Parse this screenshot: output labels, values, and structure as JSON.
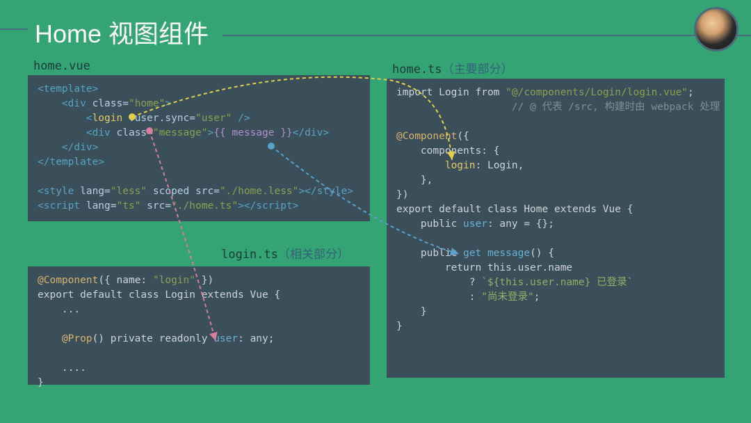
{
  "title": "Home 视图组件",
  "panels": {
    "homeVue": {
      "filename": "home.vue",
      "lines": [
        [
          {
            "t": "tag",
            "v": "<template>"
          }
        ],
        [
          {
            "t": "text",
            "v": "    "
          },
          {
            "t": "tag",
            "v": "<div "
          },
          {
            "t": "attr",
            "v": "class="
          },
          {
            "t": "str",
            "v": "\"home\""
          },
          {
            "t": "tag",
            "v": ">"
          }
        ],
        [
          {
            "t": "text",
            "v": "        "
          },
          {
            "t": "tag",
            "v": "<"
          },
          {
            "t": "component",
            "v": "login "
          },
          {
            "t": "attr",
            "v": ":user.sync="
          },
          {
            "t": "str",
            "v": "\"user\""
          },
          {
            "t": "tag",
            "v": " />"
          }
        ],
        [
          {
            "t": "text",
            "v": "        "
          },
          {
            "t": "tag",
            "v": "<div "
          },
          {
            "t": "attr",
            "v": "class="
          },
          {
            "t": "str",
            "v": "\"message\""
          },
          {
            "t": "tag",
            "v": ">"
          },
          {
            "t": "mustache",
            "v": "{{ message }}"
          },
          {
            "t": "tag",
            "v": "</div>"
          }
        ],
        [
          {
            "t": "text",
            "v": "    "
          },
          {
            "t": "tag",
            "v": "</div>"
          }
        ],
        [
          {
            "t": "tag",
            "v": "</template>"
          }
        ],
        [
          {
            "t": "text",
            "v": ""
          }
        ],
        [
          {
            "t": "tag",
            "v": "<style "
          },
          {
            "t": "attr",
            "v": "lang="
          },
          {
            "t": "str",
            "v": "\"less\" "
          },
          {
            "t": "attr",
            "v": "scoped src="
          },
          {
            "t": "str",
            "v": "\"./home.less\""
          },
          {
            "t": "tag",
            "v": "></style>"
          }
        ],
        [
          {
            "t": "tag",
            "v": "<script "
          },
          {
            "t": "attr",
            "v": "lang="
          },
          {
            "t": "str",
            "v": "\"ts\" "
          },
          {
            "t": "attr",
            "v": "src="
          },
          {
            "t": "str",
            "v": "\"./home.ts\""
          },
          {
            "t": "tag",
            "v": "></script>"
          }
        ]
      ]
    },
    "loginTs": {
      "filename": "login.ts",
      "note": "（相关部分）",
      "lines": [
        [
          {
            "t": "annotation",
            "v": "@Component"
          },
          {
            "t": "text",
            "v": "({ name: "
          },
          {
            "t": "str",
            "v": "\"login\""
          },
          {
            "t": "text",
            "v": " })"
          }
        ],
        [
          {
            "t": "text",
            "v": "export default class Login extends Vue {"
          }
        ],
        [
          {
            "t": "text",
            "v": "    ..."
          }
        ],
        [
          {
            "t": "text",
            "v": ""
          }
        ],
        [
          {
            "t": "text",
            "v": "    "
          },
          {
            "t": "annotation",
            "v": "@Prop"
          },
          {
            "t": "text",
            "v": "() private readonly "
          },
          {
            "t": "var",
            "v": "user"
          },
          {
            "t": "text",
            "v": ": any;"
          }
        ],
        [
          {
            "t": "text",
            "v": ""
          }
        ],
        [
          {
            "t": "text",
            "v": "    ...."
          }
        ],
        [
          {
            "t": "text",
            "v": "}"
          }
        ]
      ]
    },
    "homeTs": {
      "filename": "home.ts",
      "note": "（主要部分）",
      "lines": [
        [
          {
            "t": "text",
            "v": "import Login from "
          },
          {
            "t": "str",
            "v": "\"@/components/Login/login.vue\""
          },
          {
            "t": "text",
            "v": ";"
          }
        ],
        [
          {
            "t": "text",
            "v": "                   "
          },
          {
            "t": "comment",
            "v": "// @ 代表 /src, 构建时由 webpack 处理"
          }
        ],
        [
          {
            "t": "text",
            "v": ""
          }
        ],
        [
          {
            "t": "annotation",
            "v": "@Component"
          },
          {
            "t": "text",
            "v": "({"
          }
        ],
        [
          {
            "t": "text",
            "v": "    components: {"
          }
        ],
        [
          {
            "t": "text",
            "v": "        "
          },
          {
            "t": "component",
            "v": "login"
          },
          {
            "t": "text",
            "v": ": Login,"
          }
        ],
        [
          {
            "t": "text",
            "v": "    },"
          }
        ],
        [
          {
            "t": "text",
            "v": "})"
          }
        ],
        [
          {
            "t": "text",
            "v": "export default class Home extends Vue {"
          }
        ],
        [
          {
            "t": "text",
            "v": "    public "
          },
          {
            "t": "var",
            "v": "user"
          },
          {
            "t": "text",
            "v": ": any = {};"
          }
        ],
        [
          {
            "t": "text",
            "v": ""
          }
        ],
        [
          {
            "t": "text",
            "v": "    public "
          },
          {
            "t": "var",
            "v": "get message"
          },
          {
            "t": "text",
            "v": "() {"
          }
        ],
        [
          {
            "t": "text",
            "v": "        return this.user.name"
          }
        ],
        [
          {
            "t": "text",
            "v": "            ? "
          },
          {
            "t": "string",
            "v": "`${this.user.name} 已登录`"
          }
        ],
        [
          {
            "t": "text",
            "v": "            : "
          },
          {
            "t": "string",
            "v": "\"尚未登录\""
          },
          {
            "t": "text",
            "v": ";"
          }
        ],
        [
          {
            "t": "text",
            "v": "    }"
          }
        ],
        [
          {
            "t": "text",
            "v": "}"
          }
        ]
      ]
    }
  }
}
